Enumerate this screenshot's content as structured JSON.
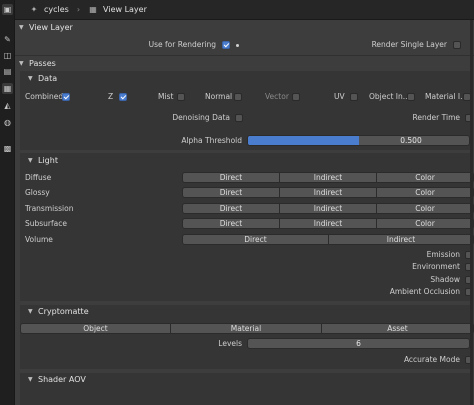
{
  "header": {
    "scene": "cycles",
    "layer": "View Layer"
  },
  "view_layer": {
    "title": "View Layer",
    "use_for_rendering": {
      "label": "Use for Rendering",
      "checked": true
    },
    "render_single_layer": {
      "label": "Render Single Layer",
      "checked": false
    }
  },
  "passes": {
    "title": "Passes",
    "data": {
      "title": "Data",
      "items": [
        {
          "label": "Combined",
          "checked": true
        },
        {
          "label": "Z",
          "checked": true
        },
        {
          "label": "Mist",
          "checked": false
        },
        {
          "label": "Normal",
          "checked": false
        },
        {
          "label": "Vector",
          "checked": false
        },
        {
          "label": "UV",
          "checked": false
        },
        {
          "label": "Object In...",
          "checked": false
        },
        {
          "label": "Material I...",
          "checked": false
        }
      ],
      "denoising_data": {
        "label": "Denoising Data",
        "checked": false
      },
      "render_time": {
        "label": "Render Time",
        "checked": false
      },
      "alpha_threshold": {
        "label": "Alpha Threshold",
        "value": "0.500",
        "fraction": 0.5
      }
    },
    "light": {
      "title": "Light",
      "rows": [
        {
          "label": "Diffuse",
          "buttons": [
            "Direct",
            "Indirect",
            "Color"
          ]
        },
        {
          "label": "Glossy",
          "buttons": [
            "Direct",
            "Indirect",
            "Color"
          ]
        },
        {
          "label": "Transmission",
          "buttons": [
            "Direct",
            "Indirect",
            "Color"
          ]
        },
        {
          "label": "Subsurface",
          "buttons": [
            "Direct",
            "Indirect",
            "Color"
          ]
        },
        {
          "label": "Volume",
          "buttons": [
            "Direct",
            "Indirect"
          ]
        }
      ],
      "toggles": [
        {
          "label": "Emission",
          "checked": false
        },
        {
          "label": "Environment",
          "checked": false
        },
        {
          "label": "Shadow",
          "checked": false
        },
        {
          "label": "Ambient Occlusion",
          "checked": false
        }
      ]
    },
    "cryptomatte": {
      "title": "Cryptomatte",
      "buttons": [
        "Object",
        "Material",
        "Asset"
      ],
      "levels": {
        "label": "Levels",
        "value": "6"
      },
      "accurate_mode": {
        "label": "Accurate Mode",
        "checked": false
      }
    },
    "shader_aov": {
      "title": "Shader AOV"
    }
  },
  "colors": {
    "accent": "#4b7dcf",
    "panel": "#3d3d3d",
    "background": "#303030"
  }
}
